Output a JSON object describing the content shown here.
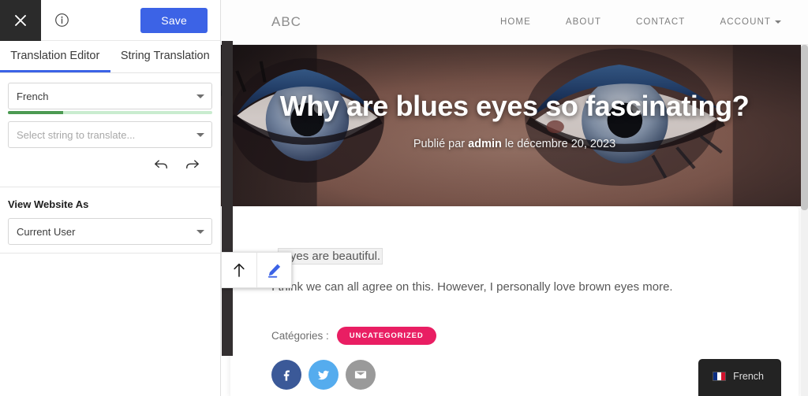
{
  "editor": {
    "close_icon": "close-icon",
    "info_icon": "info-icon",
    "save_label": "Save",
    "tabs": [
      {
        "label": "Translation Editor",
        "active": true
      },
      {
        "label": "String Translation",
        "active": false
      }
    ],
    "language_select": {
      "value": "French",
      "progress_percent": 27
    },
    "string_select": {
      "placeholder": "Select string to translate..."
    },
    "history": {
      "undo_icon": "undo-icon",
      "redo_icon": "redo-icon"
    },
    "view_website_as": {
      "label": "View Website As",
      "value": "Current User"
    },
    "accent_color": "#3c63e6",
    "progress_color": "#4c9a52"
  },
  "site": {
    "logo": "ABC",
    "nav": [
      {
        "label": "HOME",
        "has_caret": false
      },
      {
        "label": "ABOUT",
        "has_caret": false
      },
      {
        "label": "CONTACT",
        "has_caret": false
      },
      {
        "label": "ACCOUNT",
        "has_caret": true
      }
    ],
    "hero": {
      "title": "Why are blues eyes so fascinating?",
      "meta_prefix": "Publié par ",
      "meta_author": "admin",
      "meta_suffix": " le décembre 20, 2023"
    },
    "article": {
      "paragraph1_bold": "e",
      "paragraph1_highlight": " eyes are beautiful.",
      "paragraph2": "I think we can all agree on this. However, I personally love brown eyes more."
    },
    "categories": {
      "label": "Catégories :",
      "badge": "UNCATEGORIZED",
      "badge_color": "#e91e63"
    },
    "share": [
      {
        "name": "facebook",
        "glyph": "f",
        "color": "#3b5998"
      },
      {
        "name": "twitter",
        "glyph": "t",
        "color": "#55acee"
      },
      {
        "name": "email",
        "glyph": "m",
        "color": "#9a9a9a"
      }
    ],
    "language_switcher": {
      "label": "French"
    }
  },
  "overlay_toolbar": {
    "scroll_up_icon": "arrow-up-icon",
    "edit_icon": "pencil-edit-icon"
  }
}
